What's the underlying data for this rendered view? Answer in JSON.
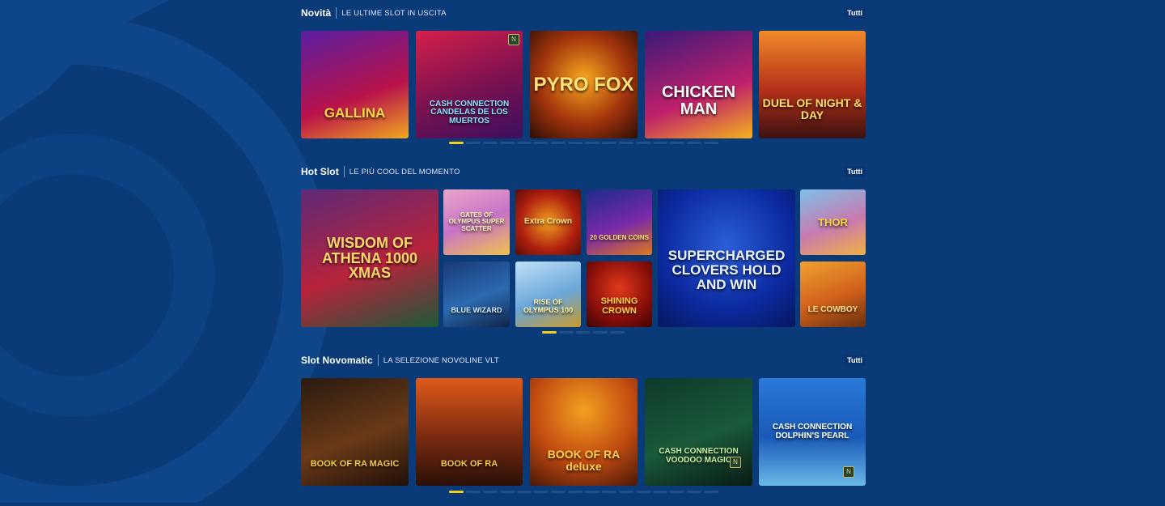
{
  "sections": [
    {
      "title": "Novità",
      "subtitle": "LE ULTIME SLOT IN USCITA",
      "all_label": "Tutti",
      "games": [
        {
          "title": "GALLINA"
        },
        {
          "title": "CASH CONNECTION CANDELAS DE LOS MUERTOS"
        },
        {
          "title": "PYRO FOX"
        },
        {
          "title": "CHICKEN MAN"
        },
        {
          "title": "DUEL OF NIGHT & DAY"
        }
      ],
      "pager": {
        "pages": 16,
        "active": 1
      }
    },
    {
      "title": "Hot Slot",
      "subtitle": "LE PIÙ COOL DEL MOMENTO",
      "all_label": "Tutti",
      "games": [
        {
          "title": "WISDOM OF ATHENA 1000 XMAS"
        },
        {
          "title": "GATES OF OLYMPUS SUPER SCATTER"
        },
        {
          "title": "Extra Crown"
        },
        {
          "title": "20 GOLDEN COINS"
        },
        {
          "title": "BLUE WIZARD"
        },
        {
          "title": "RISE OF OLYMPUS 100"
        },
        {
          "title": "SHINING CROWN"
        },
        {
          "title": "SUPERCHARGED CLOVERS HOLD AND WIN"
        },
        {
          "title": "THOR"
        },
        {
          "title": "LE COWBOY"
        }
      ],
      "pager": {
        "pages": 5,
        "active": 1
      }
    },
    {
      "title": "Slot Novomatic",
      "subtitle": "LA SELEZIONE NOVOLINE VLT",
      "all_label": "Tutti",
      "games": [
        {
          "title": "BOOK OF RA MAGIC"
        },
        {
          "title": "BOOK OF RA"
        },
        {
          "title": "BOOK OF RA deluxe"
        },
        {
          "title": "CASH CONNECTION VOODOO MAGIC"
        },
        {
          "title": "CASH CONNECTION DOLPHIN'S PEARL"
        }
      ],
      "pager": {
        "pages": 16,
        "active": 1
      }
    }
  ],
  "colors": {
    "background": "#0b3a78",
    "dot_active": "#f2d018",
    "dot_inactive": "#1e5188"
  }
}
